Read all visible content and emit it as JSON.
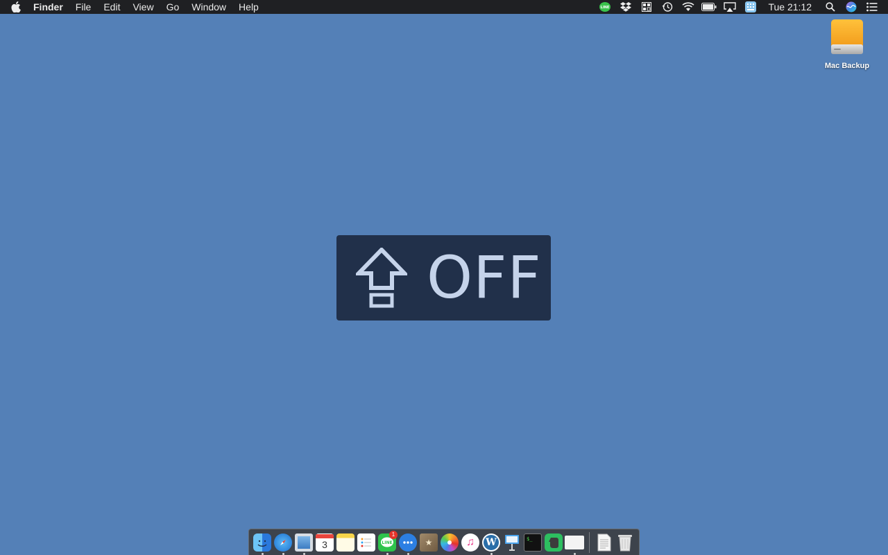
{
  "menubar": {
    "app_name": "Finder",
    "menus": [
      "File",
      "Edit",
      "View",
      "Go",
      "Window",
      "Help"
    ],
    "clock": "Tue 21:12",
    "status_icons": [
      "line-icon",
      "dropbox-icon",
      "app-grid-icon",
      "time-machine-icon",
      "wifi-icon",
      "battery-icon",
      "airplay-icon",
      "keyboard-input-icon"
    ],
    "right_icons": [
      "spotlight-icon",
      "siri-icon",
      "notification-center-icon"
    ]
  },
  "desktop": {
    "drive_label": "Mac Backup",
    "drive_color": "#f6a623"
  },
  "hud": {
    "state_text": "OFF",
    "icon": "caps-lock-icon"
  },
  "dock": {
    "apps": [
      {
        "name": "finder",
        "running": true
      },
      {
        "name": "safari",
        "running": true
      },
      {
        "name": "preview",
        "running": true
      },
      {
        "name": "calendar",
        "running": false,
        "label": "3"
      },
      {
        "name": "notes",
        "running": false
      },
      {
        "name": "reminders",
        "running": false
      },
      {
        "name": "line",
        "running": true,
        "badge": "1"
      },
      {
        "name": "messages",
        "running": true
      },
      {
        "name": "archive",
        "running": false
      },
      {
        "name": "photos",
        "running": false
      },
      {
        "name": "itunes",
        "running": false
      },
      {
        "name": "wordpress",
        "running": true
      },
      {
        "name": "keynote",
        "running": false
      },
      {
        "name": "terminal",
        "running": false
      },
      {
        "name": "evernote",
        "running": false
      },
      {
        "name": "memo",
        "running": true
      }
    ],
    "docs": [
      "document",
      "trash"
    ]
  }
}
